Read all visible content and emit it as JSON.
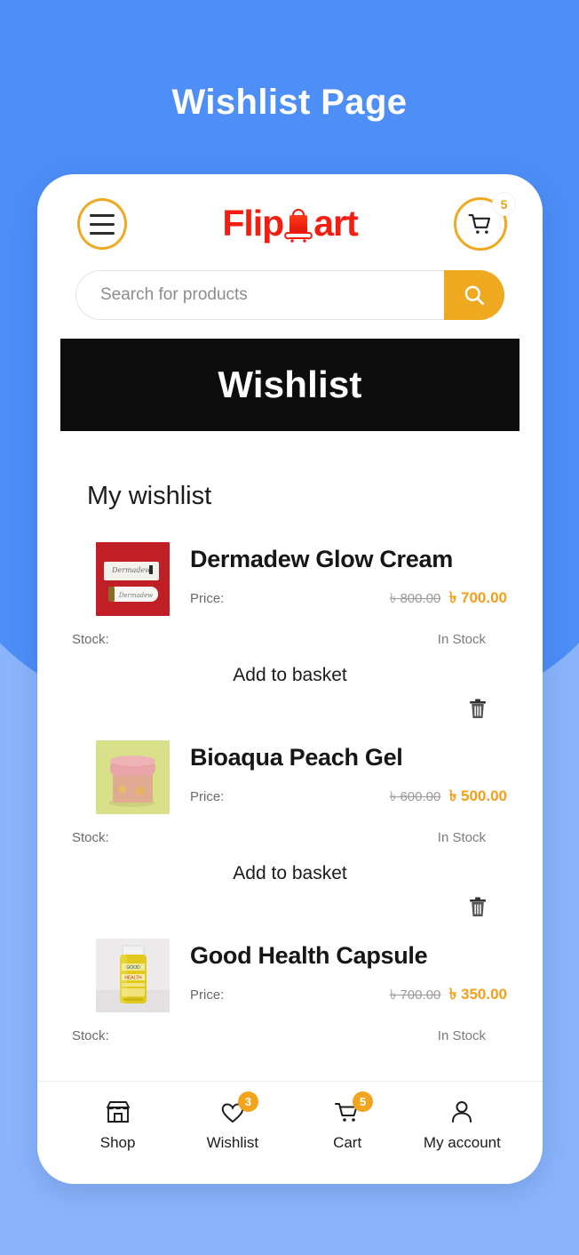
{
  "page": {
    "heading": "Wishlist Page",
    "background_color_top": "#4d8ef7",
    "background_color_bottom": "#8ab4fb"
  },
  "header": {
    "menu_icon": "hamburger-menu-icon",
    "logo_text_left": "Flip",
    "logo_text_right": "art",
    "logo_icon": "shopping-bag-icon",
    "logo_color": "#f41d10",
    "cart_icon": "shopping-cart-icon",
    "cart_badge": "5",
    "accent_color": "#efa920"
  },
  "search": {
    "placeholder": "Search for products",
    "value": "",
    "button_icon": "search-icon",
    "button_color": "#efa920"
  },
  "banner": {
    "title": "Wishlist",
    "background": "#0d0d0d",
    "text_color": "#ffffff"
  },
  "main": {
    "section_title": "My wishlist",
    "labels": {
      "price": "Price:",
      "stock": "Stock:",
      "add_to_basket": "Add to basket",
      "delete_icon": "trash-icon"
    },
    "currency_symbol": "৳",
    "price_color": "#f2a01b",
    "products": [
      {
        "name": "Dermadew Glow Cream",
        "price_old": "৳ 800.00",
        "price_new": "৳ 700.00",
        "stock": "In Stock",
        "thumb": "dermadew-cream-thumbnail"
      },
      {
        "name": "Bioaqua Peach Gel",
        "price_old": "৳ 600.00",
        "price_new": "৳ 500.00",
        "stock": "In Stock",
        "thumb": "bioaqua-gel-thumbnail"
      },
      {
        "name": "Good Health Capsule",
        "price_old": "৳ 700.00",
        "price_new": "৳ 350.00",
        "stock": "In Stock",
        "thumb": "good-health-capsule-thumbnail"
      }
    ]
  },
  "bottom_nav": {
    "items": [
      {
        "label": "Shop",
        "icon": "shop-icon",
        "badge": ""
      },
      {
        "label": "Wishlist",
        "icon": "heart-icon",
        "badge": "3"
      },
      {
        "label": "Cart",
        "icon": "cart-icon",
        "badge": "5"
      },
      {
        "label": "My account",
        "icon": "user-icon",
        "badge": ""
      }
    ],
    "badge_color": "#f2a41d"
  }
}
